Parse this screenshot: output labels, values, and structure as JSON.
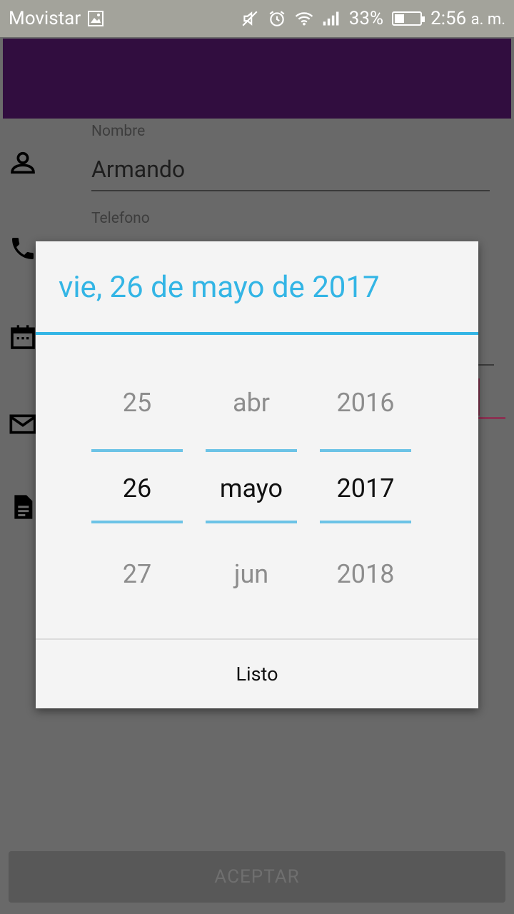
{
  "status_bar": {
    "carrier": "Movistar",
    "battery_percent": "33%",
    "battery_level": 0.33,
    "time": "2:56",
    "ampm": "a. m."
  },
  "form": {
    "nombre_label": "Nombre",
    "nombre_value": "Armando",
    "telefono_label": "Telefono",
    "accept_button": "ACEPTAR"
  },
  "date_picker": {
    "header": "vie, 26 de mayo de 2017",
    "day": {
      "prev": "25",
      "selected": "26",
      "next": "27"
    },
    "month": {
      "prev": "abr",
      "selected": "mayo",
      "next": "jun"
    },
    "year": {
      "prev": "2016",
      "selected": "2017",
      "next": "2018"
    },
    "done_button": "Listo",
    "accent_color": "#33b5e5"
  },
  "colors": {
    "app_bar": "#310d3f",
    "overlay": "#696969"
  }
}
